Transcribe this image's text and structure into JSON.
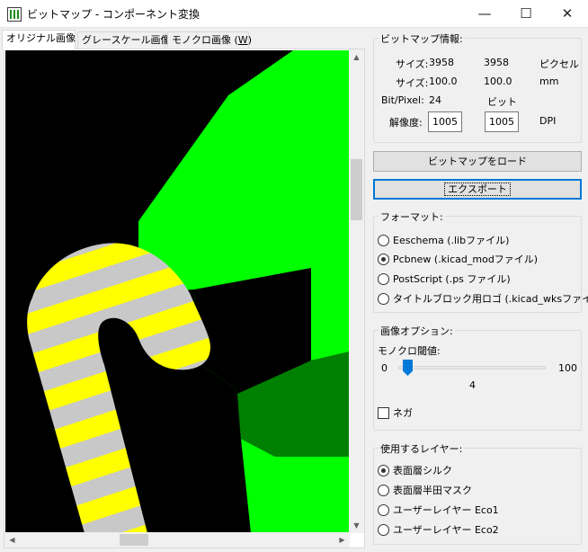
{
  "window": {
    "title": "ビットマップ - コンポーネント変換",
    "minimize_glyph": "—",
    "maximize_glyph": "☐",
    "close_glyph": "✕"
  },
  "tabs": [
    {
      "label": "オリジナル画像",
      "active": true
    },
    {
      "label": "グレースケール画像",
      "active": false
    },
    {
      "label": "モノクロ画像 (",
      "mnemonic": "W",
      "suffix": ")",
      "active": false
    }
  ],
  "bitmap_info": {
    "title": "ビットマップ情報:",
    "size_px_label": "サイズ:",
    "size_px_w": "3958",
    "size_px_h": "3958",
    "size_px_unit": "ピクセル",
    "size_mm_label": "サイズ:",
    "size_mm_w": "100.0",
    "size_mm_h": "100.0",
    "size_mm_unit": "mm",
    "bpp_label": "Bit/Pixel:",
    "bpp_value": "24",
    "bpp_unit": "ビット",
    "resolution_label": "解像度:",
    "resolution_x": "1005",
    "resolution_y": "1005",
    "resolution_unit": "DPI"
  },
  "buttons": {
    "load": "ビットマップをロード",
    "export": "エクスポート"
  },
  "format": {
    "title": "フォーマット:",
    "options": [
      {
        "label": "Eeschema (.libファイル)",
        "selected": false
      },
      {
        "label": "Pcbnew (.kicad_modファイル)",
        "selected": true
      },
      {
        "label": "PostScript (.ps ファイル)",
        "selected": false
      },
      {
        "label": "タイトルブロック用ロゴ (.kicad_wksファイル)",
        "selected": false
      }
    ]
  },
  "image_options": {
    "title": "画像オプション:",
    "threshold_label": "モノクロ閾値:",
    "slider_min": "0",
    "slider_max": "100",
    "slider_value": "4",
    "negative_label": "ネガ",
    "negative_checked": false
  },
  "layer": {
    "title": "使用するレイヤー:",
    "options": [
      {
        "label": "表面層シルク",
        "selected": true
      },
      {
        "label": "表面層半田マスク",
        "selected": false
      },
      {
        "label": "ユーザーレイヤー Eco1",
        "selected": false
      },
      {
        "label": "ユーザーレイヤー Eco2",
        "selected": false
      }
    ]
  },
  "colors": {
    "bright_green": "#00ff00",
    "dark_green": "#008000",
    "black": "#000000",
    "yellow": "#ffff00",
    "stripe_gray": "#c8c8c8",
    "accent": "#0078d7"
  }
}
